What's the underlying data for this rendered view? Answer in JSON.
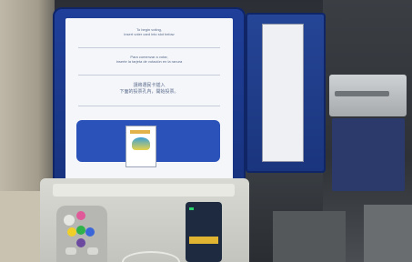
{
  "screen": {
    "line1": "To begin voting,",
    "line2": "insert voter card into slot below",
    "line3": "Para comenzar a votar,",
    "line4": "inserte la tarjeta de votación en la ranura",
    "line5": "請將選民卡插入",
    "line6": "下面的投票孔內，開始投票。",
    "footer": ""
  },
  "door": {
    "label": ""
  },
  "colors": {
    "terminal": "#1f3f9a",
    "screen": "#f4f6fa",
    "banner": "#2a52b8",
    "card_strip": "#e0b431"
  }
}
